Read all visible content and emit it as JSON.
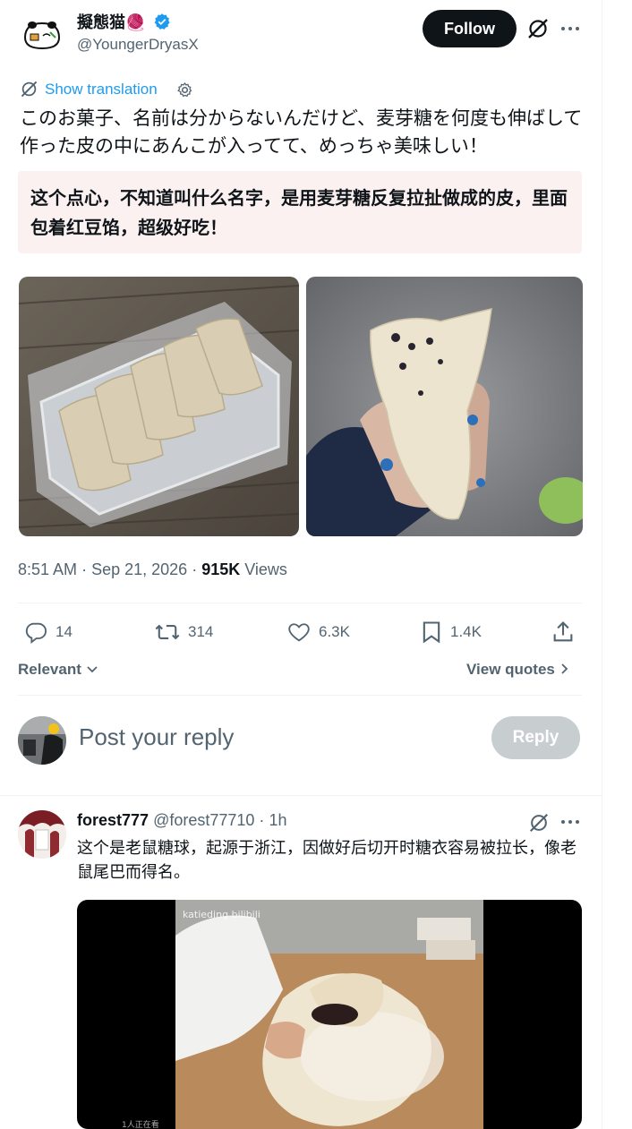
{
  "post": {
    "display_name": "擬態猫🧶",
    "handle": "@YoungerDryasX",
    "follow_label": "Follow",
    "show_translation": "Show translation",
    "original_text": "このお菓子、名前は分からないんだけど、麦芽糖を何度も伸ばして作った皮の中にあんこが入ってて、めっちゃ美味しい！",
    "translated_text": "这个点心，不知道叫什么名字，是用麦芽糖反复拉扯做成的皮，里面包着红豆馅，超级好吃！",
    "time": "8:51 AM",
    "date": "Sep 21, 2026",
    "views_count": "915K",
    "views_label": "Views",
    "stats": {
      "replies": "14",
      "reposts": "314",
      "likes": "6.3K",
      "bookmarks": "1.4K"
    }
  },
  "sort": {
    "relevant_label": "Relevant",
    "view_quotes_label": "View quotes"
  },
  "composer": {
    "placeholder": "Post your reply",
    "reply_label": "Reply"
  },
  "replies": [
    {
      "display_name": "forest777",
      "handle": "@forest77710",
      "time": "1h",
      "text": "这个是老鼠糖球，起源于浙江，因做好后切开时糖衣容易被拉长，像老鼠尾巴而得名。",
      "video_watermark": "katieding bilibili",
      "video_footer": "1人正在看"
    }
  ],
  "colors": {
    "accent": "#1d9bf0",
    "muted": "#536471",
    "translation_bg": "#fbf1f0",
    "follow_bg": "#0f1419"
  }
}
